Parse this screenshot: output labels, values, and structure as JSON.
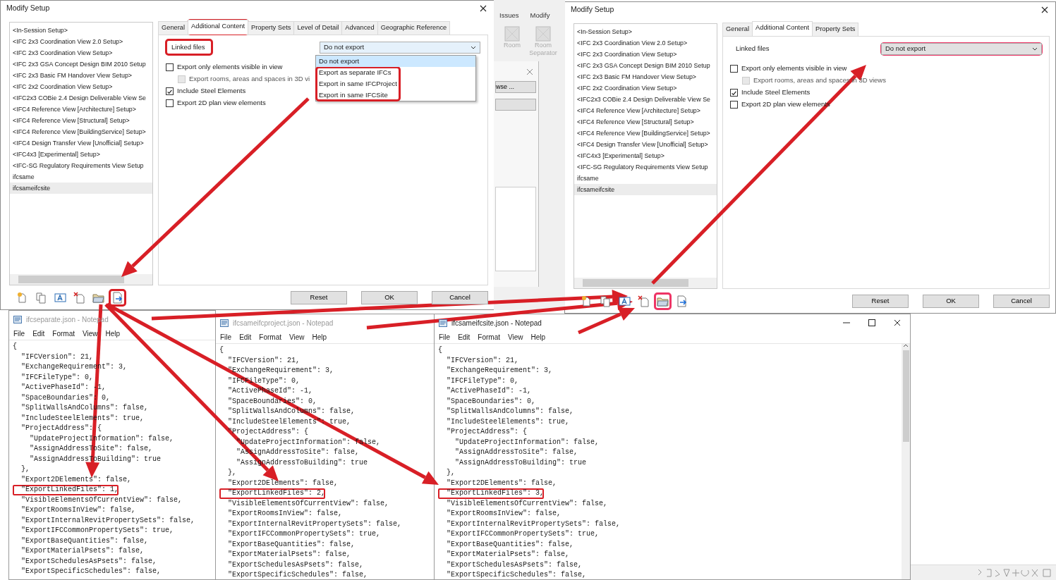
{
  "dialogs": [
    {
      "title": "Modify Setup",
      "setups": [
        {
          "label": "<In-Session Setup>",
          "selected": false
        },
        {
          "label": "<IFC 2x3 Coordination View 2.0 Setup>",
          "selected": false
        },
        {
          "label": "<IFC 2x3 Coordination View Setup>",
          "selected": false
        },
        {
          "label": "<IFC 2x3 GSA Concept Design BIM 2010 Setup",
          "selected": false
        },
        {
          "label": "<IFC 2x3 Basic FM Handover View Setup>",
          "selected": false
        },
        {
          "label": "<IFC 2x2 Coordination View Setup>",
          "selected": false
        },
        {
          "label": "<IFC2x3 COBie 2.4 Design Deliverable View Se",
          "selected": false
        },
        {
          "label": "<IFC4 Reference View [Architecture] Setup>",
          "selected": false
        },
        {
          "label": "<IFC4 Reference View [Structural] Setup>",
          "selected": false
        },
        {
          "label": "<IFC4 Reference View [BuildingService] Setup>",
          "selected": false
        },
        {
          "label": "<IFC4 Design Transfer View [Unofficial] Setup>",
          "selected": false
        },
        {
          "label": "<IFC4x3 [Experimental] Setup>",
          "selected": false
        },
        {
          "label": "<IFC-SG Regulatory Requirements View Setup",
          "selected": false
        },
        {
          "label": "ifcsame",
          "selected": false
        },
        {
          "label": "ifcsameifcsite",
          "selected": true
        }
      ],
      "tabs": [
        {
          "label": "General",
          "selected": false,
          "circled": false
        },
        {
          "label": "Additional Content",
          "selected": true,
          "circled": true
        },
        {
          "label": "Property Sets",
          "selected": false,
          "circled": false
        },
        {
          "label": "Level of Detail",
          "selected": false,
          "circled": false
        },
        {
          "label": "Advanced",
          "selected": false,
          "circled": false
        },
        {
          "label": "Geographic Reference",
          "selected": false,
          "circled": false
        }
      ],
      "linked_files": {
        "label": "Linked files",
        "label_circled": true,
        "value": "Do not export",
        "value_circled": false,
        "expanded": true,
        "options": [
          {
            "label": "Do not export",
            "selected": true,
            "circled": false
          },
          {
            "label": "Export as separate IFCs",
            "selected": false,
            "circled": true
          },
          {
            "label": "Export in same IFCProject",
            "selected": false,
            "circled": true
          },
          {
            "label": "Export in same IFCSite",
            "selected": false,
            "circled": true
          }
        ]
      },
      "checkboxes": [
        {
          "label": "Export only elements visible in view",
          "checked": false,
          "disabled": false
        },
        {
          "label": "Export rooms, areas and spaces in 3D vi",
          "checked": false,
          "disabled": true
        },
        {
          "label": "Include Steel Elements",
          "checked": true,
          "disabled": false
        },
        {
          "label": "Export 2D plan view elements",
          "checked": false,
          "disabled": false
        }
      ],
      "toolbar": [
        {
          "kind": "new",
          "circled": false
        },
        {
          "kind": "copy",
          "circled": false
        },
        {
          "kind": "rename",
          "circled": false
        },
        {
          "kind": "delete",
          "circled": false
        },
        {
          "kind": "load",
          "circled": false
        },
        {
          "kind": "save",
          "circled": true
        }
      ],
      "buttons": [
        "Reset",
        "OK",
        "Cancel"
      ]
    },
    {
      "title": "Modify Setup",
      "setups": [
        {
          "label": "<In-Session Setup>",
          "selected": false
        },
        {
          "label": "<IFC 2x3 Coordination View 2.0 Setup>",
          "selected": false
        },
        {
          "label": "<IFC 2x3 Coordination View Setup>",
          "selected": false
        },
        {
          "label": "<IFC 2x3 GSA Concept Design BIM 2010 Setup",
          "selected": false
        },
        {
          "label": "<IFC 2x3 Basic FM Handover View Setup>",
          "selected": false
        },
        {
          "label": "<IFC 2x2 Coordination View Setup>",
          "selected": false
        },
        {
          "label": "<IFC2x3 COBie 2.4 Design Deliverable View Se",
          "selected": false
        },
        {
          "label": "<IFC4 Reference View [Architecture] Setup>",
          "selected": false
        },
        {
          "label": "<IFC4 Reference View [Structural] Setup>",
          "selected": false
        },
        {
          "label": "<IFC4 Reference View [BuildingService] Setup>",
          "selected": false
        },
        {
          "label": "<IFC4 Design Transfer View [Unofficial] Setup>",
          "selected": false
        },
        {
          "label": "<IFC4x3 [Experimental] Setup>",
          "selected": false
        },
        {
          "label": "<IFC-SG Regulatory Requirements View Setup",
          "selected": false
        },
        {
          "label": "ifcsame",
          "selected": false
        },
        {
          "label": "ifcsameifcsite",
          "selected": true
        }
      ],
      "tabs": [
        {
          "label": "General",
          "selected": false,
          "circled": false
        },
        {
          "label": "Additional Content",
          "selected": true,
          "circled": false
        },
        {
          "label": "Property Sets",
          "selected": false,
          "circled": false
        }
      ],
      "linked_files": {
        "label": "Linked files",
        "label_circled": false,
        "value": "Do not export",
        "value_circled": true,
        "expanded": false
      },
      "checkboxes": [
        {
          "label": "Export only elements visible in view",
          "checked": false,
          "disabled": false
        },
        {
          "label": "Export rooms, areas and spaces in 3D views",
          "checked": false,
          "disabled": true
        },
        {
          "label": "Include Steel Elements",
          "checked": true,
          "disabled": false
        },
        {
          "label": "Export 2D plan view elements",
          "checked": false,
          "disabled": false
        }
      ],
      "toolbar": [
        {
          "kind": "new",
          "circled": false
        },
        {
          "kind": "copy",
          "circled": false
        },
        {
          "kind": "rename",
          "circled": false
        },
        {
          "kind": "delete",
          "circled": false
        },
        {
          "kind": "load",
          "circled": true
        },
        {
          "kind": "save",
          "circled": false
        }
      ],
      "buttons": [
        "Reset",
        "OK",
        "Cancel"
      ]
    }
  ],
  "revit_background": {
    "ribbon_tabs": [
      "Issues",
      "Modify"
    ],
    "ribbon_buttons": [
      "Room",
      "Room Separator"
    ],
    "dialog_button": "wse ..."
  },
  "notepads": [
    {
      "title": "ifcseparate.json - Notepad",
      "active": false,
      "menu": [
        "File",
        "Edit",
        "Format",
        "View",
        "Help"
      ],
      "lines": [
        {
          "text": "{",
          "circled": false
        },
        {
          "text": "  \"IFCVersion\": 21,",
          "circled": false
        },
        {
          "text": "  \"ExchangeRequirement\": 3,",
          "circled": false
        },
        {
          "text": "  \"IFCFileType\": 0,",
          "circled": false
        },
        {
          "text": "  \"ActivePhaseId\": -1,",
          "circled": false
        },
        {
          "text": "  \"SpaceBoundaries\": 0,",
          "circled": false
        },
        {
          "text": "  \"SplitWallsAndColumns\": false,",
          "circled": false
        },
        {
          "text": "  \"IncludeSteelElements\": true,",
          "circled": false
        },
        {
          "text": "  \"ProjectAddress\": {",
          "circled": false
        },
        {
          "text": "    \"UpdateProjectInformation\": false,",
          "circled": false
        },
        {
          "text": "    \"AssignAddressToSite\": false,",
          "circled": false
        },
        {
          "text": "    \"AssignAddressToBuilding\": true",
          "circled": false
        },
        {
          "text": "  },",
          "circled": false
        },
        {
          "text": "  \"Export2DElements\": false,",
          "circled": false
        },
        {
          "text": "  \"ExportLinkedFiles\": 1,",
          "circled": true
        },
        {
          "text": "  \"VisibleElementsOfCurrentView\": false,",
          "circled": false
        },
        {
          "text": "  \"ExportRoomsInView\": false,",
          "circled": false
        },
        {
          "text": "  \"ExportInternalRevitPropertySets\": false,",
          "circled": false
        },
        {
          "text": "  \"ExportIFCCommonPropertySets\": true,",
          "circled": false
        },
        {
          "text": "  \"ExportBaseQuantities\": false,",
          "circled": false
        },
        {
          "text": "  \"ExportMaterialPsets\": false,",
          "circled": false
        },
        {
          "text": "  \"ExportSchedulesAsPsets\": false,",
          "circled": false
        },
        {
          "text": "  \"ExportSpecificSchedules\": false,",
          "circled": false
        }
      ]
    },
    {
      "title": "ifcsameifcproject.json - Notepad",
      "active": false,
      "menu": [
        "File",
        "Edit",
        "Format",
        "View",
        "Help"
      ],
      "lines": [
        {
          "text": "{",
          "circled": false
        },
        {
          "text": "  \"IFCVersion\": 21,",
          "circled": false
        },
        {
          "text": "  \"ExchangeRequirement\": 3,",
          "circled": false
        },
        {
          "text": "  \"IFCFileType\": 0,",
          "circled": false
        },
        {
          "text": "  \"ActivePhaseId\": -1,",
          "circled": false
        },
        {
          "text": "  \"SpaceBoundaries\": 0,",
          "circled": false
        },
        {
          "text": "  \"SplitWallsAndColumns\": false,",
          "circled": false
        },
        {
          "text": "  \"IncludeSteelElements\": true,",
          "circled": false
        },
        {
          "text": "  \"ProjectAddress\": {",
          "circled": false
        },
        {
          "text": "    \"UpdateProjectInformation\": false,",
          "circled": false
        },
        {
          "text": "    \"AssignAddressToSite\": false,",
          "circled": false
        },
        {
          "text": "    \"AssignAddressToBuilding\": true",
          "circled": false
        },
        {
          "text": "  },",
          "circled": false
        },
        {
          "text": "  \"Export2DElements\": false,",
          "circled": false
        },
        {
          "text": "  \"ExportLinkedFiles\": 2,",
          "circled": true
        },
        {
          "text": "  \"VisibleElementsOfCurrentView\": false,",
          "circled": false
        },
        {
          "text": "  \"ExportRoomsInView\": false,",
          "circled": false
        },
        {
          "text": "  \"ExportInternalRevitPropertySets\": false,",
          "circled": false
        },
        {
          "text": "  \"ExportIFCCommonPropertySets\": true,",
          "circled": false
        },
        {
          "text": "  \"ExportBaseQuantities\": false,",
          "circled": false
        },
        {
          "text": "  \"ExportMaterialPsets\": false,",
          "circled": false
        },
        {
          "text": "  \"ExportSchedulesAsPsets\": false,",
          "circled": false
        },
        {
          "text": "  \"ExportSpecificSchedules\": false,",
          "circled": false
        }
      ]
    },
    {
      "title": "ifcsameifcsite.json - Notepad",
      "active": true,
      "menu": [
        "File",
        "Edit",
        "Format",
        "View",
        "Help"
      ],
      "lines": [
        {
          "text": "{",
          "circled": false
        },
        {
          "text": "  \"IFCVersion\": 21,",
          "circled": false
        },
        {
          "text": "  \"ExchangeRequirement\": 3,",
          "circled": false
        },
        {
          "text": "  \"IFCFileType\": 0,",
          "circled": false
        },
        {
          "text": "  \"ActivePhaseId\": -1,",
          "circled": false
        },
        {
          "text": "  \"SpaceBoundaries\": 0,",
          "circled": false
        },
        {
          "text": "  \"SplitWallsAndColumns\": false,",
          "circled": false
        },
        {
          "text": "  \"IncludeSteelElements\": true,",
          "circled": false
        },
        {
          "text": "  \"ProjectAddress\": {",
          "circled": false
        },
        {
          "text": "    \"UpdateProjectInformation\": false,",
          "circled": false
        },
        {
          "text": "    \"AssignAddressToSite\": false,",
          "circled": false
        },
        {
          "text": "    \"AssignAddressToBuilding\": true",
          "circled": false
        },
        {
          "text": "  },",
          "circled": false
        },
        {
          "text": "  \"Export2DElements\": false,",
          "circled": false
        },
        {
          "text": "  \"ExportLinkedFiles\": 3,",
          "circled": true
        },
        {
          "text": "  \"VisibleElementsOfCurrentView\": false,",
          "circled": false
        },
        {
          "text": "  \"ExportRoomsInView\": false,",
          "circled": false
        },
        {
          "text": "  \"ExportInternalRevitPropertySets\": false,",
          "circled": false
        },
        {
          "text": "  \"ExportIFCCommonPropertySets\": true,",
          "circled": false
        },
        {
          "text": "  \"ExportBaseQuantities\": false,",
          "circled": false
        },
        {
          "text": "  \"ExportMaterialPsets\": false,",
          "circled": false
        },
        {
          "text": "  \"ExportSchedulesAsPsets\": false,",
          "circled": false
        },
        {
          "text": "  \"ExportSpecificSchedules\": false,",
          "circled": false
        }
      ]
    }
  ]
}
